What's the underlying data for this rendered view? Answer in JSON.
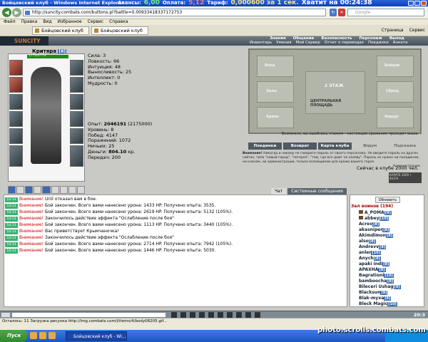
{
  "browser": {
    "title": "Бойцовский клуб - Windows Internet Explorer",
    "url": "http://suncity.combats.com/buttons.pl?battle=0.00933418337172753",
    "search_placeholder": "Google",
    "menu": [
      "Файл",
      "Правка",
      "Вид",
      "Избранное",
      "Сервис",
      "Справка"
    ],
    "tabs": [
      "Бойцовский клуб",
      "Бойцовский клуб"
    ],
    "tab_tools": [
      "Страница",
      "Сервис"
    ]
  },
  "billing": {
    "advance_label": "Авансы:",
    "advance_value": "6,00",
    "payment_label": "Оплата:",
    "payment_value": "5,12",
    "tariff_label": "Тариф:",
    "tariff_value": "0,000600 за 1 сек.",
    "enough_label": "Хватит на 00:24:38"
  },
  "game": {
    "logo": "SUNCITY",
    "nav_top": [
      "Знания",
      "Общение",
      "Безопасность",
      "Персонаж",
      "Выход"
    ],
    "nav_sub": [
      "Инвентарь",
      "Умения",
      "Мой Сервер",
      "Отчет о переводах",
      "Поединки",
      "Анкета"
    ],
    "character": {
      "name": "Критяра",
      "level": "[8]",
      "hp": "1773/1773"
    },
    "stats": [
      "Сила: 3",
      "Ловкость: 66",
      "Интуиция: 48",
      "Выносливость: 25",
      "Интеллект: 0",
      "Мудрость: 0"
    ],
    "exp": [
      {
        "label": "Опыт: ",
        "value": "2046191",
        "extra": " (2175000)"
      },
      {
        "label": "Уровень: ",
        "value": "8",
        "extra": ""
      },
      {
        "label": "Побед: ",
        "value": "4147",
        "extra": ""
      },
      {
        "label": "Поражений: ",
        "value": "1072",
        "extra": ""
      },
      {
        "label": "Ничьих: ",
        "value": "25",
        "extra": ""
      },
      {
        "label": "Деньги: ",
        "value": "804.10",
        "extra": " кр."
      },
      {
        "label": "Передач: ",
        "value": "200",
        "extra": ""
      }
    ],
    "map": {
      "center": "2 ЭТАЖ",
      "center2": "ЦЕНТРАЛЬНАЯ ПЛОЩАДЬ",
      "rooms": [
        "Вход",
        "Бойцов",
        "Залы",
        "Сброд",
        "Арена",
        "Хирург"
      ],
      "caption": "Возможно, вы ошиблись этажом - настоящие сражения проходят выше."
    },
    "map_buttons": [
      "Поединки",
      "Возврат",
      "Карта клуба",
      "Форум",
      "Подсказка"
    ],
    "warning_title": "Внимание!",
    "warning_text": "Никогда и никому не говорите пароль от своего персонажа. Не вводите пароль на других сайтах, типа \"новый город\", \"лотерея\", \"там, где все дают на халяву\". Пароль не нужен ни паладинам, ни кланам, ни администрации, только взломщикам для кражи вашего героя.",
    "admin": "Администрация.",
    "online": "Сейчас в клубе 2000 чел.",
    "counter": "КАРАТЕ 2000 • 46374",
    "chat_tabs": [
      "Чат",
      "Системные сообщения"
    ],
    "chat": [
      {
        "time": "14:13",
        "prefix": "Внимание!",
        "text": " Uriil отказал вам в бое."
      },
      {
        "time": "14:13",
        "prefix": "Внимание!",
        "text": " Бой закончен. Всего вами нанесено урона: 1433 HP. Получено опыта: 3535."
      },
      {
        "time": "14:13",
        "prefix": "Внимание!",
        "text": " Бой закончен. Всего вами нанесено урона: 2619 HP. Получено опыта: 5132 (105%)."
      },
      {
        "time": "14:13",
        "prefix": "Внимание!",
        "text": " Закончилось действие эффекта \"Ослабление после боя\""
      },
      {
        "time": "14:13",
        "prefix": "Внимание!",
        "text": " Бой закончен. Всего вами нанесено урона: 1113 HP. Получено опыта: 3440 (105%)."
      },
      {
        "time": "14:13",
        "prefix": "Внимание!",
        "text": " Вас приветствует Крымчаночка!"
      },
      {
        "time": "14:13",
        "prefix": "Внимание!",
        "text": " Закончилось действие эффекта \"Ослабление после боя\""
      },
      {
        "time": "14:13",
        "prefix": "Внимание!",
        "text": " Бой закончен. Всего вами нанесено урона: 2714 HP. Получено опыта: 7942 (105%)."
      },
      {
        "time": "14:13",
        "prefix": "Внимание!",
        "text": " Бой закончен. Всего вами нанесено урона: 1446 HP. Получено опыта: 5030."
      }
    ],
    "refresh": "Обновить",
    "players_title": "Зал воинов (194)",
    "players": [
      {
        "name": "A_POMA",
        "lvl": "[9]"
      },
      {
        "name": "abbey",
        "lvl": "[10]"
      },
      {
        "name": "Acrev",
        "lvl": "[8]"
      },
      {
        "name": "akasniper",
        "lvl": "[8]"
      },
      {
        "name": "Akimdimon",
        "lvl": "[8]"
      },
      {
        "name": "also",
        "lvl": "[8]"
      },
      {
        "name": "Andrevv",
        "lvl": "[9]"
      },
      {
        "name": "anler",
        "lvl": "[10]"
      },
      {
        "name": "Anych",
        "lvl": "[8]"
      },
      {
        "name": "apaki indi",
        "lvl": "[8]"
      },
      {
        "name": "APAXHA",
        "lvl": "[8]"
      },
      {
        "name": "Bagrationi",
        "lvl": "[10]"
      },
      {
        "name": "bamboocha",
        "lvl": "[8]"
      },
      {
        "name": "Bileceri Ushag",
        "lvl": "[9]"
      },
      {
        "name": "Blacksun",
        "lvl": "[9]"
      },
      {
        "name": "Blak-myxa",
        "lvl": "[9]"
      },
      {
        "name": "Bleck Magic",
        "lvl": "[10]"
      }
    ],
    "clock": "20:3"
  },
  "status": "Осталось: 11 Загрузка рисунка http://img.combats.com/i/items/4/body08205.gif...",
  "taskbar": {
    "start": "Пуск",
    "item": "Бойцовский клуб - Wi..."
  },
  "watermark": "photo.scrolls.combats.com"
}
